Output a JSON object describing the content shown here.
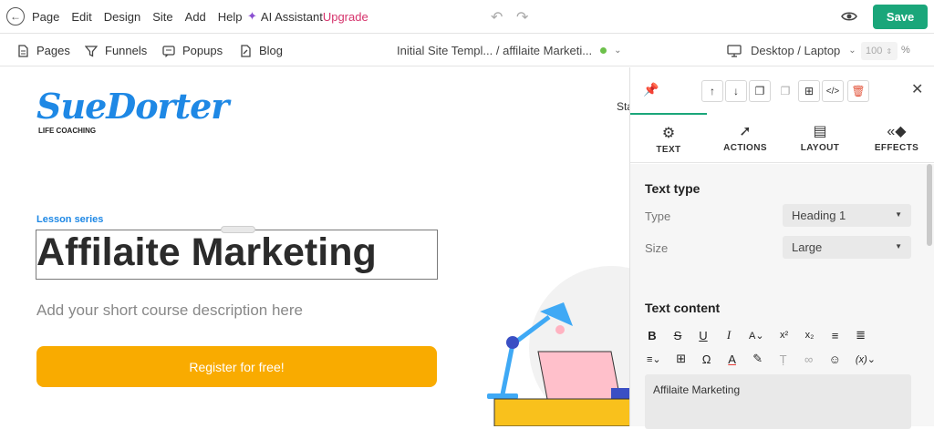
{
  "topbar": {
    "menu": [
      "Page",
      "Edit",
      "Design",
      "Site",
      "Add",
      "Help"
    ],
    "ai_assistant": "AI Assistant",
    "upgrade": "Upgrade",
    "save_label": "Save"
  },
  "secbar": {
    "pages": "Pages",
    "funnels": "Funnels",
    "popups": "Popups",
    "blog": "Blog",
    "site_path": "Initial Site Templ... / affilaite Marketi...",
    "device": "Desktop / Laptop",
    "zoom": "100",
    "zoom_unit": "%"
  },
  "canvas": {
    "logo_main": "SueDorter",
    "logo_sub": "LIFE COACHING",
    "nav_partial": "Sta",
    "lesson": "Lesson series",
    "heading": "Affilaite Marketing",
    "description": "Add your short course description here",
    "register": "Register for free!"
  },
  "panel": {
    "tabs": [
      {
        "label": "TEXT",
        "icon": "gear-icon"
      },
      {
        "label": "ACTIONS",
        "icon": "cursor-click-icon"
      },
      {
        "label": "LAYOUT",
        "icon": "layout-icon"
      },
      {
        "label": "EFFECTS",
        "icon": "effects-icon"
      }
    ],
    "text_type_title": "Text type",
    "type_label": "Type",
    "type_value": "Heading 1",
    "size_label": "Size",
    "size_value": "Large",
    "text_content_title": "Text content",
    "editor_value": "Affilaite Marketing"
  },
  "colors": {
    "accent": "#1aa67a",
    "upgrade": "#d6336c",
    "brand_blue": "#1e88e5",
    "button_orange": "#f9ab00"
  }
}
